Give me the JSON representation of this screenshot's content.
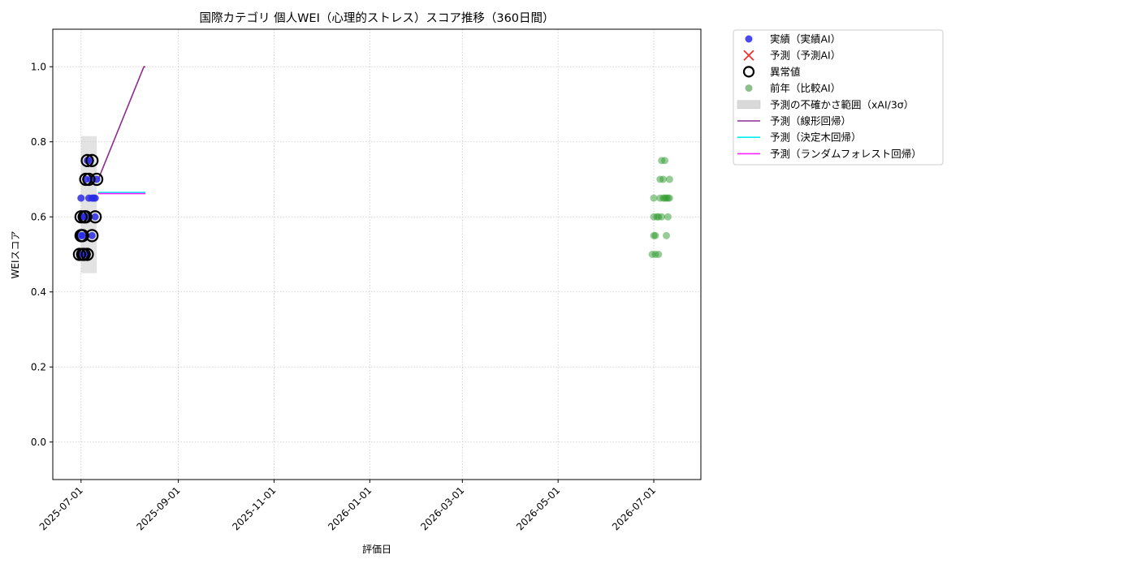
{
  "chart_data": {
    "type": "scatter",
    "title": "国際カテゴリ 個人WEI（心理的ストレス）スコア推移（360日間）",
    "xlabel": "評価日",
    "ylabel": "WEIスコア",
    "xlim": [
      "2025-06-13",
      "2026-07-31"
    ],
    "ylim": [
      -0.1,
      1.1
    ],
    "x_ticks": [
      "2025-07-01",
      "2025-09-01",
      "2025-11-01",
      "2026-01-01",
      "2026-03-01",
      "2026-05-01",
      "2026-07-01"
    ],
    "y_ticks": [
      0.0,
      0.2,
      0.4,
      0.6,
      0.8,
      1.0
    ],
    "y_tick_labels": [
      "0.0",
      "0.2",
      "0.4",
      "0.6",
      "0.8",
      "1.0"
    ],
    "grid": true,
    "legend_position": "outside-top-right",
    "legend": [
      {
        "label": "実績（実績AI）",
        "kind": "dot",
        "color": "#2a2ae6"
      },
      {
        "label": "予測（予測AI）",
        "kind": "cross",
        "color": "#ee3333"
      },
      {
        "label": "異常値",
        "kind": "ring",
        "color": "#000000"
      },
      {
        "label": "前年（比較AI）",
        "kind": "dot-faint",
        "color": "#66aa66"
      },
      {
        "label": "予測の不確かさ範囲（xAI/3σ）",
        "kind": "band",
        "color": "#d9d9d9"
      },
      {
        "label": "予測（線形回帰）",
        "kind": "line",
        "color": "#8e2c8e"
      },
      {
        "label": "予測（決定木回帰）",
        "kind": "line",
        "color": "#00f0f0"
      },
      {
        "label": "予測（ランダムフォレスト回帰）",
        "kind": "line",
        "color": "#ff22ff"
      }
    ],
    "uncertainty_band": {
      "x_start": "2025-07-01",
      "x_end": "2025-07-11",
      "y_low": 0.45,
      "y_high": 0.815
    },
    "series": [
      {
        "name": "実績（実績AI）",
        "type": "scatter",
        "color": "#2a2ae6",
        "points": [
          [
            "2025-06-30",
            0.5
          ],
          [
            "2025-07-01",
            0.55
          ],
          [
            "2025-07-01",
            0.6
          ],
          [
            "2025-07-01",
            0.65
          ],
          [
            "2025-07-02",
            0.5
          ],
          [
            "2025-07-02",
            0.55
          ],
          [
            "2025-07-03",
            0.6
          ],
          [
            "2025-07-03",
            0.5
          ],
          [
            "2025-07-04",
            0.7
          ],
          [
            "2025-07-04",
            0.6
          ],
          [
            "2025-07-05",
            0.75
          ],
          [
            "2025-07-05",
            0.5
          ],
          [
            "2025-07-06",
            0.65
          ],
          [
            "2025-07-07",
            0.7
          ],
          [
            "2025-07-07",
            0.75
          ],
          [
            "2025-07-08",
            0.55
          ],
          [
            "2025-07-08",
            0.65
          ],
          [
            "2025-07-09",
            0.65
          ],
          [
            "2025-07-10",
            0.6
          ],
          [
            "2025-07-10",
            0.65
          ],
          [
            "2025-07-11",
            0.7
          ]
        ]
      },
      {
        "name": "異常値",
        "type": "ring",
        "color": "#000000",
        "points": [
          [
            "2025-06-30",
            0.5
          ],
          [
            "2025-07-01",
            0.55
          ],
          [
            "2025-07-01",
            0.6
          ],
          [
            "2025-07-02",
            0.5
          ],
          [
            "2025-07-02",
            0.55
          ],
          [
            "2025-07-03",
            0.6
          ],
          [
            "2025-07-03",
            0.5
          ],
          [
            "2025-07-04",
            0.7
          ],
          [
            "2025-07-04",
            0.6
          ],
          [
            "2025-07-05",
            0.75
          ],
          [
            "2025-07-05",
            0.5
          ],
          [
            "2025-07-06",
            0.7
          ],
          [
            "2025-07-08",
            0.75
          ],
          [
            "2025-07-08",
            0.55
          ],
          [
            "2025-07-10",
            0.6
          ],
          [
            "2025-07-11",
            0.7
          ]
        ]
      },
      {
        "name": "前年（比較AI）",
        "type": "scatter-faint",
        "color": "#2e9a2e",
        "points": [
          [
            "2026-06-30",
            0.5
          ],
          [
            "2026-07-01",
            0.55
          ],
          [
            "2026-07-01",
            0.65
          ],
          [
            "2026-07-01",
            0.6
          ],
          [
            "2026-07-02",
            0.5
          ],
          [
            "2026-07-02",
            0.55
          ],
          [
            "2026-07-03",
            0.6
          ],
          [
            "2026-07-04",
            0.6
          ],
          [
            "2026-07-04",
            0.5
          ],
          [
            "2026-07-05",
            0.7
          ],
          [
            "2026-07-05",
            0.65
          ],
          [
            "2026-07-06",
            0.75
          ],
          [
            "2026-07-06",
            0.6
          ],
          [
            "2026-07-07",
            0.65
          ],
          [
            "2026-07-07",
            0.7
          ],
          [
            "2026-07-08",
            0.75
          ],
          [
            "2026-07-08",
            0.65
          ],
          [
            "2026-07-09",
            0.55
          ],
          [
            "2026-07-09",
            0.65
          ],
          [
            "2026-07-10",
            0.6
          ],
          [
            "2026-07-10",
            0.65
          ],
          [
            "2026-07-11",
            0.7
          ],
          [
            "2026-07-11",
            0.65
          ]
        ]
      },
      {
        "name": "予測（線形回帰）",
        "type": "line",
        "color": "#8e2c8e",
        "points": [
          [
            "2025-07-12",
            0.7
          ],
          [
            "2025-08-10",
            1.0
          ],
          [
            "2025-08-11",
            1.0
          ]
        ]
      },
      {
        "name": "予測（決定木回帰）",
        "type": "line",
        "color": "#00f0f0",
        "points": [
          [
            "2025-07-12",
            0.665
          ],
          [
            "2025-08-11",
            0.665
          ]
        ]
      },
      {
        "name": "予測（ランダムフォレスト回帰）",
        "type": "line",
        "color": "#ff22ff",
        "points": [
          [
            "2025-07-12",
            0.662
          ],
          [
            "2025-08-11",
            0.662
          ]
        ]
      }
    ]
  }
}
